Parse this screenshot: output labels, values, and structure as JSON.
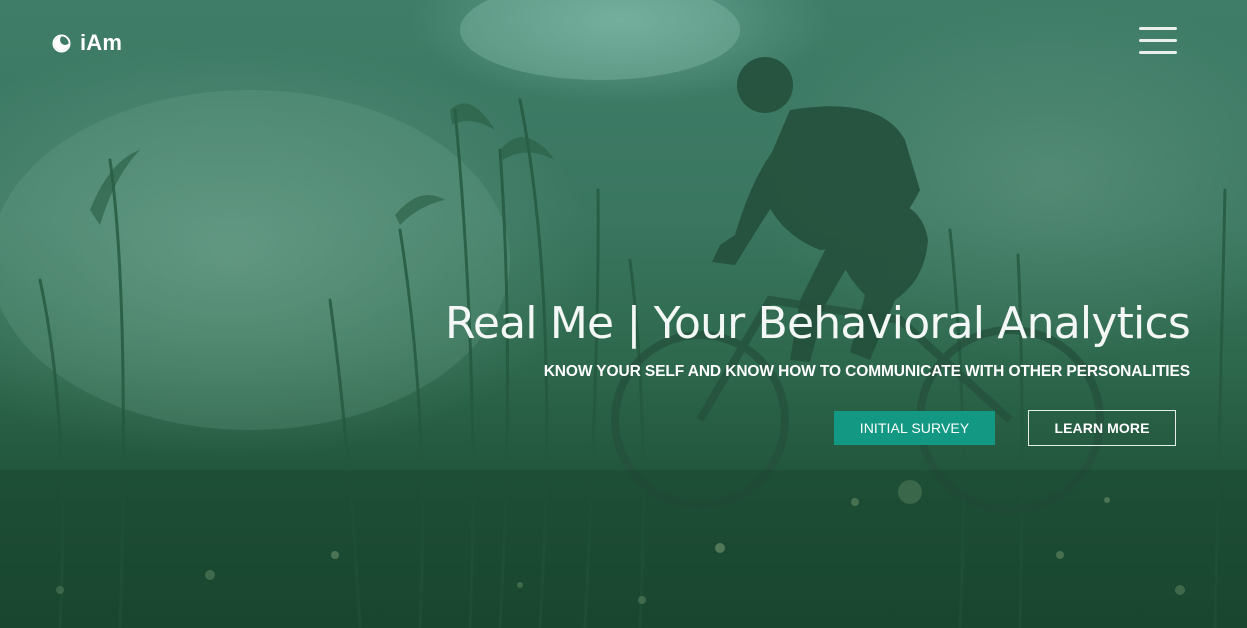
{
  "brand": {
    "name": "iAm",
    "logo_icon": "crescent-moon-icon"
  },
  "nav": {
    "menu_icon": "hamburger-menu-icon"
  },
  "hero": {
    "title": "Real Me | Your Behavioral Analytics",
    "subtitle": "KNOW YOUR SELF AND KNOW HOW TO COMMUNICATE WITH OTHER PERSONALITIES",
    "primary_button": "INITIAL SURVEY",
    "secondary_button": "LEARN MORE"
  },
  "colors": {
    "overlay_green": "#2f6a4f",
    "accent_teal": "#129883",
    "text": "#ffffff"
  }
}
